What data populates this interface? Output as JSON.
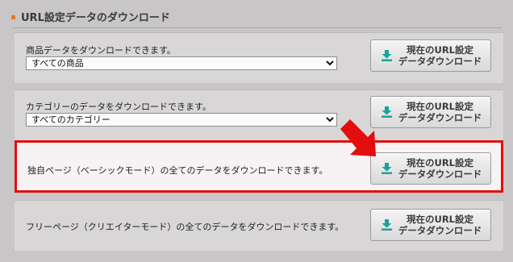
{
  "section": {
    "title": "URL設定データのダウンロード"
  },
  "rows": [
    {
      "description": "商品データをダウンロードできます。",
      "select": {
        "selected": "すべての商品"
      },
      "button": {
        "line1": "現在のURL設定",
        "line2": "データダウンロード"
      }
    },
    {
      "description": "カテゴリーのデータをダウンロードできます。",
      "select": {
        "selected": "すべてのカテゴリー"
      },
      "button": {
        "line1": "現在のURL設定",
        "line2": "データダウンロード"
      }
    },
    {
      "description": "独自ページ（ベーシックモード）の全てのデータをダウンロードできます。",
      "button": {
        "line1": "現在のURL設定",
        "line2": "データダウンロード"
      }
    },
    {
      "description": "フリーページ（クリエイターモード）の全てのデータをダウンロードできます。",
      "button": {
        "line1": "現在のURL設定",
        "line2": "データダウンロード"
      }
    }
  ],
  "colors": {
    "accent_bullet": "#e07a2a",
    "highlight_border": "#e30d0d",
    "download_icon": "#1aa39a"
  },
  "icons": {
    "download": "download-arrow-icon",
    "annotation": "red-pointer-arrow-icon"
  }
}
